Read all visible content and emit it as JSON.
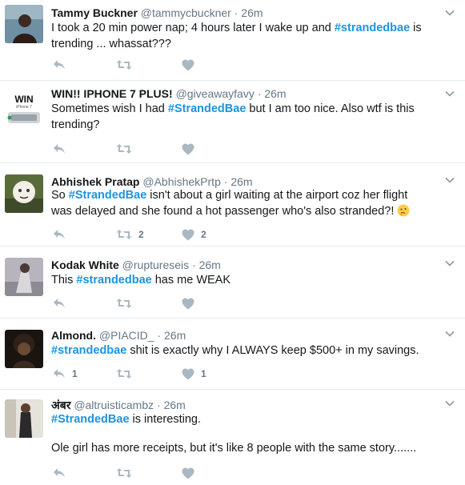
{
  "tweets": [
    {
      "name": "Tammy Buckner",
      "handle": "@tammycbuckner",
      "time": "26m",
      "segments": [
        {
          "t": "I took a 20 min power nap; 4 hours later I wake up and "
        },
        {
          "t": "#strandedbae",
          "tag": true
        },
        {
          "t": " is trending ... whassat???"
        }
      ],
      "retweets": "",
      "likes": ""
    },
    {
      "name": "WIN!! IPHONE 7 PLUS!",
      "handle": "@giveawayfavy",
      "time": "26m",
      "avatar_text": "WIN",
      "avatar_sub": "iPhone 7",
      "segments": [
        {
          "t": "Sometimes wish I had "
        },
        {
          "t": "#StrandedBae",
          "tag": true
        },
        {
          "t": " but I am too nice. Also wtf is this trending?"
        }
      ],
      "retweets": "",
      "likes": ""
    },
    {
      "name": "Abhishek Pratap",
      "handle": "@AbhishekPrtp",
      "time": "26m",
      "segments": [
        {
          "t": "So "
        },
        {
          "t": "#StrandedBae",
          "tag": true
        },
        {
          "t": " isn't about a girl waiting at the airport coz her flight was delayed and she found a hot passenger who's also stranded?! "
        }
      ],
      "emoji": "thinking-face",
      "retweets": "2",
      "likes": "2"
    },
    {
      "name": "Kodak White",
      "handle": "@ruptureseis",
      "time": "26m",
      "segments": [
        {
          "t": "This "
        },
        {
          "t": "#strandedbae",
          "tag": true
        },
        {
          "t": " has me WEAK"
        }
      ],
      "retweets": "",
      "likes": ""
    },
    {
      "name": "Almond.",
      "handle": "@PIACID_",
      "time": "26m",
      "segments": [
        {
          "t": "#strandedbae",
          "tag": true
        },
        {
          "t": " shit is exactly why I ALWAYS keep $500+ in my savings."
        }
      ],
      "replies": "1",
      "retweets": "",
      "likes": "1"
    },
    {
      "name": "अंबर",
      "handle": "@altruisticambz",
      "time": "26m",
      "segments": [
        {
          "t": "#StrandedBae",
          "tag": true
        },
        {
          "t": " is interesting."
        }
      ],
      "second_paragraph": "Ole girl has more receipts, but it's like 8 people with the same story.......",
      "retweets": "",
      "likes": ""
    }
  ],
  "colors": {
    "hashtag": "#1c94e0",
    "meta": "#657786",
    "icon": "#aab8c2",
    "divider": "#e6ecf0"
  },
  "icons": {
    "reply": "reply-icon",
    "retweet": "retweet-icon",
    "like": "heart-icon",
    "caret": "chevron-down-icon"
  }
}
